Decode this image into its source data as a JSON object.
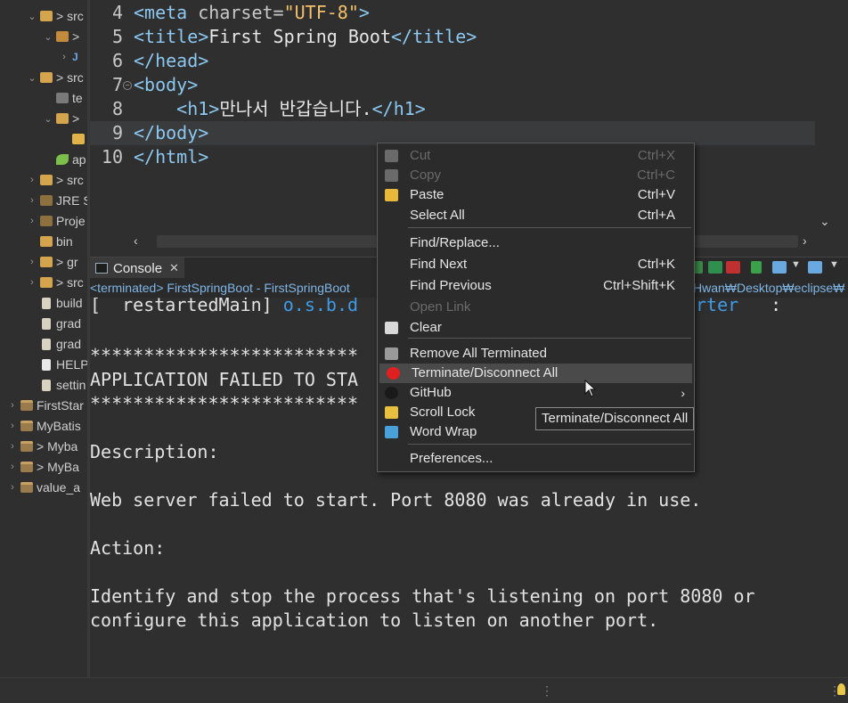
{
  "sidebar": {
    "rows": [
      {
        "twisty": "⌄",
        "icon": "folder",
        "label": "> src"
      },
      {
        "twisty": "⌄",
        "icon": "pkg",
        "label": ">"
      },
      {
        "twisty": "›",
        "icon": "java",
        "label": ""
      },
      {
        "twisty": "⌄",
        "icon": "folder",
        "label": "> src"
      },
      {
        "twisty": "",
        "icon": "grid",
        "label": "te"
      },
      {
        "twisty": "⌄",
        "icon": "folder",
        "label": ">"
      },
      {
        "twisty": "",
        "icon": "html",
        "label": ""
      },
      {
        "twisty": "",
        "icon": "leaf",
        "label": "ap"
      },
      {
        "twisty": "›",
        "icon": "folder",
        "label": "> src"
      },
      {
        "twisty": "›",
        "icon": "lib",
        "label": "JRE S"
      },
      {
        "twisty": "›",
        "icon": "lib",
        "label": "Proje"
      },
      {
        "twisty": "",
        "icon": "folder",
        "label": "bin"
      },
      {
        "twisty": "›",
        "icon": "folder",
        "label": "> gr"
      },
      {
        "twisty": "›",
        "icon": "folder",
        "label": "> src"
      },
      {
        "twisty": "",
        "icon": "gfile",
        "label": "build"
      },
      {
        "twisty": "",
        "icon": "gfile",
        "label": "grad"
      },
      {
        "twisty": "",
        "icon": "gfile",
        "label": "grad"
      },
      {
        "twisty": "",
        "icon": "file",
        "label": "HELP"
      },
      {
        "twisty": "",
        "icon": "gfile",
        "label": "settin"
      },
      {
        "twisty": "›",
        "icon": "proj",
        "label": "FirstStar"
      },
      {
        "twisty": "›",
        "icon": "proj",
        "label": "MyBatis"
      },
      {
        "twisty": "›",
        "icon": "proj",
        "label": "> Myba"
      },
      {
        "twisty": "›",
        "icon": "proj",
        "label": "> MyBa"
      },
      {
        "twisty": "›",
        "icon": "proj",
        "label": "value_a"
      }
    ]
  },
  "editor": {
    "lines": [
      {
        "num": "4",
        "parts": [
          [
            "tag",
            "<meta "
          ],
          [
            "attr",
            "charset="
          ],
          [
            "val",
            "\"UTF-8\""
          ],
          [
            "tag",
            ">"
          ]
        ]
      },
      {
        "num": "5",
        "parts": [
          [
            "tag",
            "<title>"
          ],
          [
            "txt",
            "First Spring Boot"
          ],
          [
            "tag",
            "</title>"
          ]
        ]
      },
      {
        "num": "6",
        "parts": [
          [
            "tag",
            "</head>"
          ]
        ]
      },
      {
        "num": "7",
        "parts": [
          [
            "tag",
            "<body>"
          ]
        ]
      },
      {
        "num": "8",
        "parts": [
          [
            "txt",
            "    "
          ],
          [
            "tag",
            "<h1>"
          ],
          [
            "txt",
            "만나서 반갑습니다."
          ],
          [
            "tag",
            "</h1>"
          ]
        ]
      },
      {
        "num": "9",
        "parts": [
          [
            "tag",
            "</body>"
          ]
        ]
      },
      {
        "num": "10",
        "parts": [
          [
            "tag",
            "</html>"
          ]
        ]
      }
    ]
  },
  "console": {
    "tab_label": "Console",
    "subtitle_prefix": "<terminated> ",
    "subtitle_text": "FirstSpringBoot - FirstSpringBoot",
    "subtitle_right": "Hwan₩Desktop₩eclipse₩",
    "lines": [
      {
        "text": "[  restartedMain] ",
        "link": "o.s.b.d",
        "text2": "",
        "link2": "rter",
        "tail": "   :"
      },
      {
        "text": "",
        "link": "",
        "text2": "",
        "link2": "",
        "tail": ""
      },
      {
        "text": "*************************",
        "link": "",
        "text2": "",
        "link2": "",
        "tail": ""
      },
      {
        "text": "APPLICATION FAILED TO STA",
        "link": "",
        "text2": "",
        "link2": "",
        "tail": ""
      },
      {
        "text": "*************************",
        "link": "",
        "text2": "",
        "link2": "",
        "tail": ""
      },
      {
        "text": "",
        "link": "",
        "text2": "",
        "link2": "",
        "tail": ""
      },
      {
        "text": "Description:",
        "link": "",
        "text2": "",
        "link2": "",
        "tail": ""
      },
      {
        "text": "",
        "link": "",
        "text2": "",
        "link2": "",
        "tail": ""
      },
      {
        "text": "Web server failed to start. Port 8080 was already in use.",
        "link": "",
        "text2": "",
        "link2": "",
        "tail": ""
      },
      {
        "text": "",
        "link": "",
        "text2": "",
        "link2": "",
        "tail": ""
      },
      {
        "text": "Action:",
        "link": "",
        "text2": "",
        "link2": "",
        "tail": ""
      },
      {
        "text": "",
        "link": "",
        "text2": "",
        "link2": "",
        "tail": ""
      },
      {
        "text": "Identify and stop the process that's listening on port 8080 or",
        "link": "",
        "text2": "",
        "link2": "",
        "tail": ""
      },
      {
        "text": "configure this application to listen on another port.",
        "link": "",
        "text2": "",
        "link2": "",
        "tail": ""
      }
    ]
  },
  "context_menu": {
    "items": [
      {
        "label": "Cut",
        "accel": "Ctrl+X",
        "icon": "cut-icon",
        "disabled": true
      },
      {
        "label": "Copy",
        "accel": "Ctrl+C",
        "icon": "copy-icon",
        "disabled": true
      },
      {
        "label": "Paste",
        "accel": "Ctrl+V",
        "icon": "paste-icon",
        "disabled": false
      },
      {
        "label": "Select All",
        "accel": "Ctrl+A",
        "icon": "",
        "disabled": false
      },
      {
        "label": "Find/Replace...",
        "accel": "",
        "icon": "",
        "disabled": false
      },
      {
        "label": "Find Next",
        "accel": "Ctrl+K",
        "icon": "",
        "disabled": false
      },
      {
        "label": "Find Previous",
        "accel": "Ctrl+Shift+K",
        "icon": "",
        "disabled": false
      },
      {
        "label": "Open Link",
        "accel": "",
        "icon": "",
        "disabled": true
      },
      {
        "label": "Clear",
        "accel": "",
        "icon": "clear-icon",
        "disabled": false
      },
      {
        "label": "Remove All Terminated",
        "accel": "",
        "icon": "remove-all-terminated-icon",
        "disabled": false
      },
      {
        "label": "Terminate/Disconnect All",
        "accel": "",
        "icon": "terminate-icon",
        "disabled": false,
        "highlighted": true
      },
      {
        "label": "GitHub",
        "accel": "",
        "icon": "github-icon",
        "disabled": false,
        "submenu": true
      },
      {
        "label": "Scroll Lock",
        "accel": "",
        "icon": "scroll-lock-icon",
        "disabled": false
      },
      {
        "label": "Word Wrap",
        "accel": "",
        "icon": "word-wrap-icon",
        "disabled": false
      },
      {
        "label": "Preferences...",
        "accel": "",
        "icon": "",
        "disabled": false
      }
    ]
  },
  "tooltip": "Terminate/Disconnect All",
  "colors": {
    "tag": "#8cc8f0",
    "string": "#f3c06a",
    "link": "#3f9be6",
    "terminate": "#e02020"
  }
}
